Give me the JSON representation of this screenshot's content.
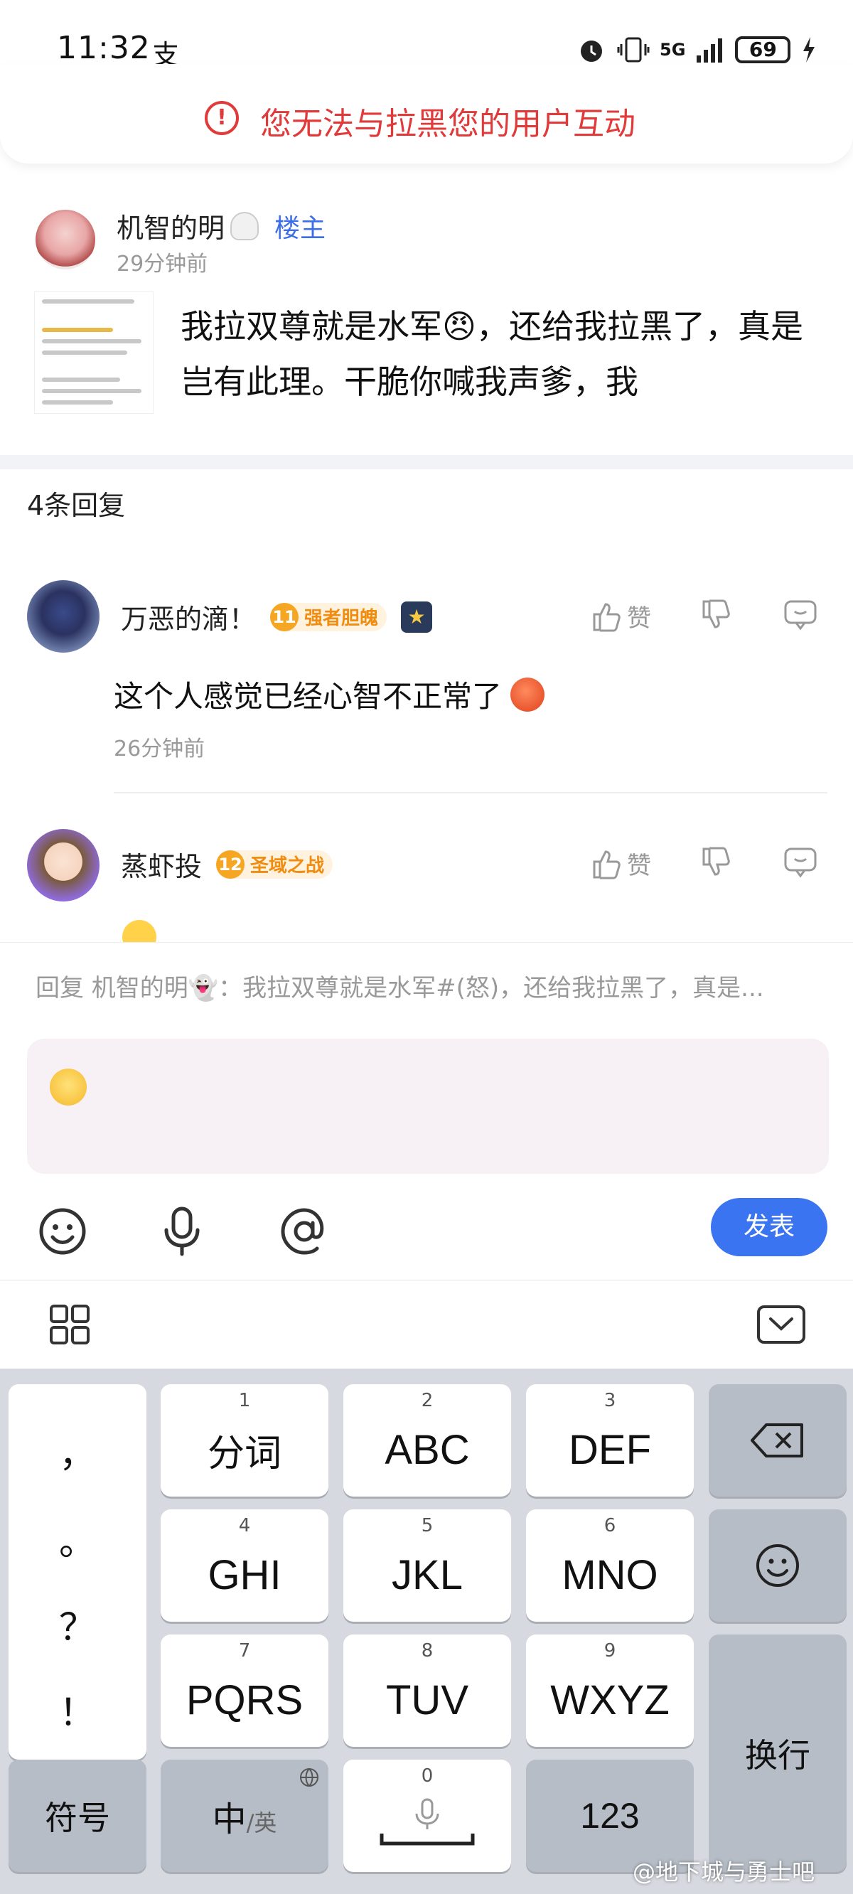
{
  "status_bar": {
    "time": "11:32",
    "carrier_icon": "支",
    "network": "5G",
    "battery": "69"
  },
  "banner": {
    "message": "您无法与拉黑您的用户互动"
  },
  "post": {
    "author": "机智的明",
    "author_emoji": "ghost-emoji",
    "owner_tag": "楼主",
    "time": "29分钟前",
    "text": "我拉双尊就是水军😠，还给我拉黑了，真是岂有此理。干脆你喊我声爹，我"
  },
  "replies_header": "4条回复",
  "comments": [
    {
      "author": "万恶的滴！",
      "level": "11",
      "level_title": "强者胆魄",
      "text": "这个人感觉已经心智不正常了",
      "time": "26分钟前",
      "like_label": "赞"
    },
    {
      "author": "蒸虾投",
      "level": "12",
      "level_title": "圣域之战",
      "like_label": "赞"
    }
  ],
  "composer": {
    "reply_hint": "回复 机智的明👻：我拉双尊就是水军#(怒)，还给我拉黑了，真是...",
    "send_label": "发表"
  },
  "keyboard": {
    "punct": [
      "，",
      "。",
      "？",
      "！"
    ],
    "keys": [
      {
        "num": "1",
        "label": "分词"
      },
      {
        "num": "2",
        "label": "ABC"
      },
      {
        "num": "3",
        "label": "DEF"
      },
      {
        "num": "4",
        "label": "GHI"
      },
      {
        "num": "5",
        "label": "JKL"
      },
      {
        "num": "6",
        "label": "MNO"
      },
      {
        "num": "7",
        "label": "PQRS"
      },
      {
        "num": "8",
        "label": "TUV"
      },
      {
        "num": "9",
        "label": "WXYZ"
      }
    ],
    "enter_label": "换行",
    "symbol_label": "符号",
    "lang_label_main": "中",
    "lang_label_sub": "/英",
    "space_num": "0",
    "num_label": "123"
  },
  "watermark": "@地下城与勇士吧",
  "colors": {
    "accent": "#3b74f0",
    "warning": "#e03a3a",
    "owner_tag": "#3b6ee8"
  }
}
